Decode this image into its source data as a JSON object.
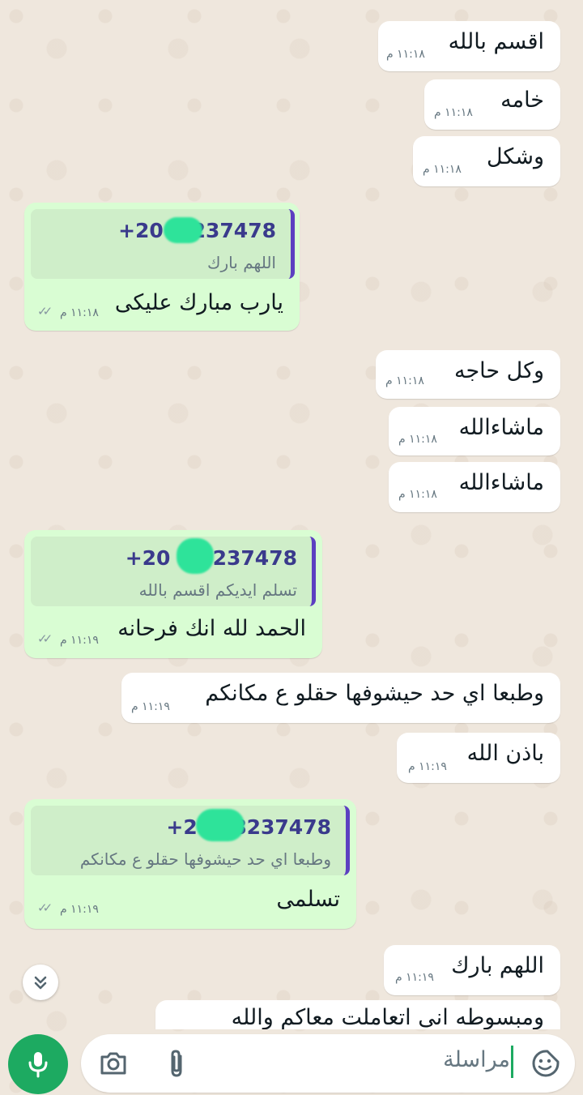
{
  "messages": [
    {
      "dir": "in",
      "text": "اقسم بالله",
      "time": "١١:١٨ م"
    },
    {
      "dir": "in",
      "text": "خامه",
      "time": "١١:١٨ م"
    },
    {
      "dir": "in",
      "text": "وشكل",
      "time": "١١:١٨ م"
    },
    {
      "dir": "out",
      "quote_sender": "+20 1    237478",
      "quote_text": "اللهم بارك",
      "text": "يارب مبارك عليكى",
      "time": "١١:١٨ م"
    },
    {
      "dir": "in",
      "text": "وكل حاجه",
      "time": "١١:١٨ م"
    },
    {
      "dir": "in",
      "text": "ماشاءالله",
      "time": "١١:١٨ م"
    },
    {
      "dir": "in",
      "text": "ماشاءالله",
      "time": "١١:١٨ م"
    },
    {
      "dir": "out",
      "quote_sender": "+20 1    8237478",
      "quote_text": "تسلم ايديكم اقسم بالله",
      "text": "الحمد لله انك فرحانه",
      "time": "١١:١٩ م"
    },
    {
      "dir": "in",
      "text": "وطبعا اي حد حيشوفها حقلو ع مكانكم",
      "time": "١١:١٩ م"
    },
    {
      "dir": "in",
      "text": "باذن الله",
      "time": "١١:١٩ م"
    },
    {
      "dir": "out",
      "quote_sender": "+20      48237478",
      "quote_text": "وطبعا اي حد حيشوفها حقلو ع مكانكم",
      "text": "تسلمى",
      "time": "١١:١٩ م"
    },
    {
      "dir": "in",
      "text": "اللهم بارك",
      "time": "١١:١٩ م"
    },
    {
      "dir": "in",
      "text": "ومبسوطه انى اتعاملت معاكم والله",
      "time": ""
    }
  ],
  "composer": {
    "placeholder": "مراسلة",
    "emoji_icon": "sticker-emoji-icon",
    "attach_icon": "paperclip-icon",
    "camera_icon": "camera-icon",
    "mic_icon": "microphone-icon"
  },
  "scroll_down_icon": "double-chevron-down-icon",
  "colors": {
    "incoming_bubble": "#ffffff",
    "outgoing_bubble": "#d9fdd3",
    "accent_green": "#1daa61",
    "quote_bar": "#5c3fc1",
    "wallpaper": "#efe7dd"
  }
}
